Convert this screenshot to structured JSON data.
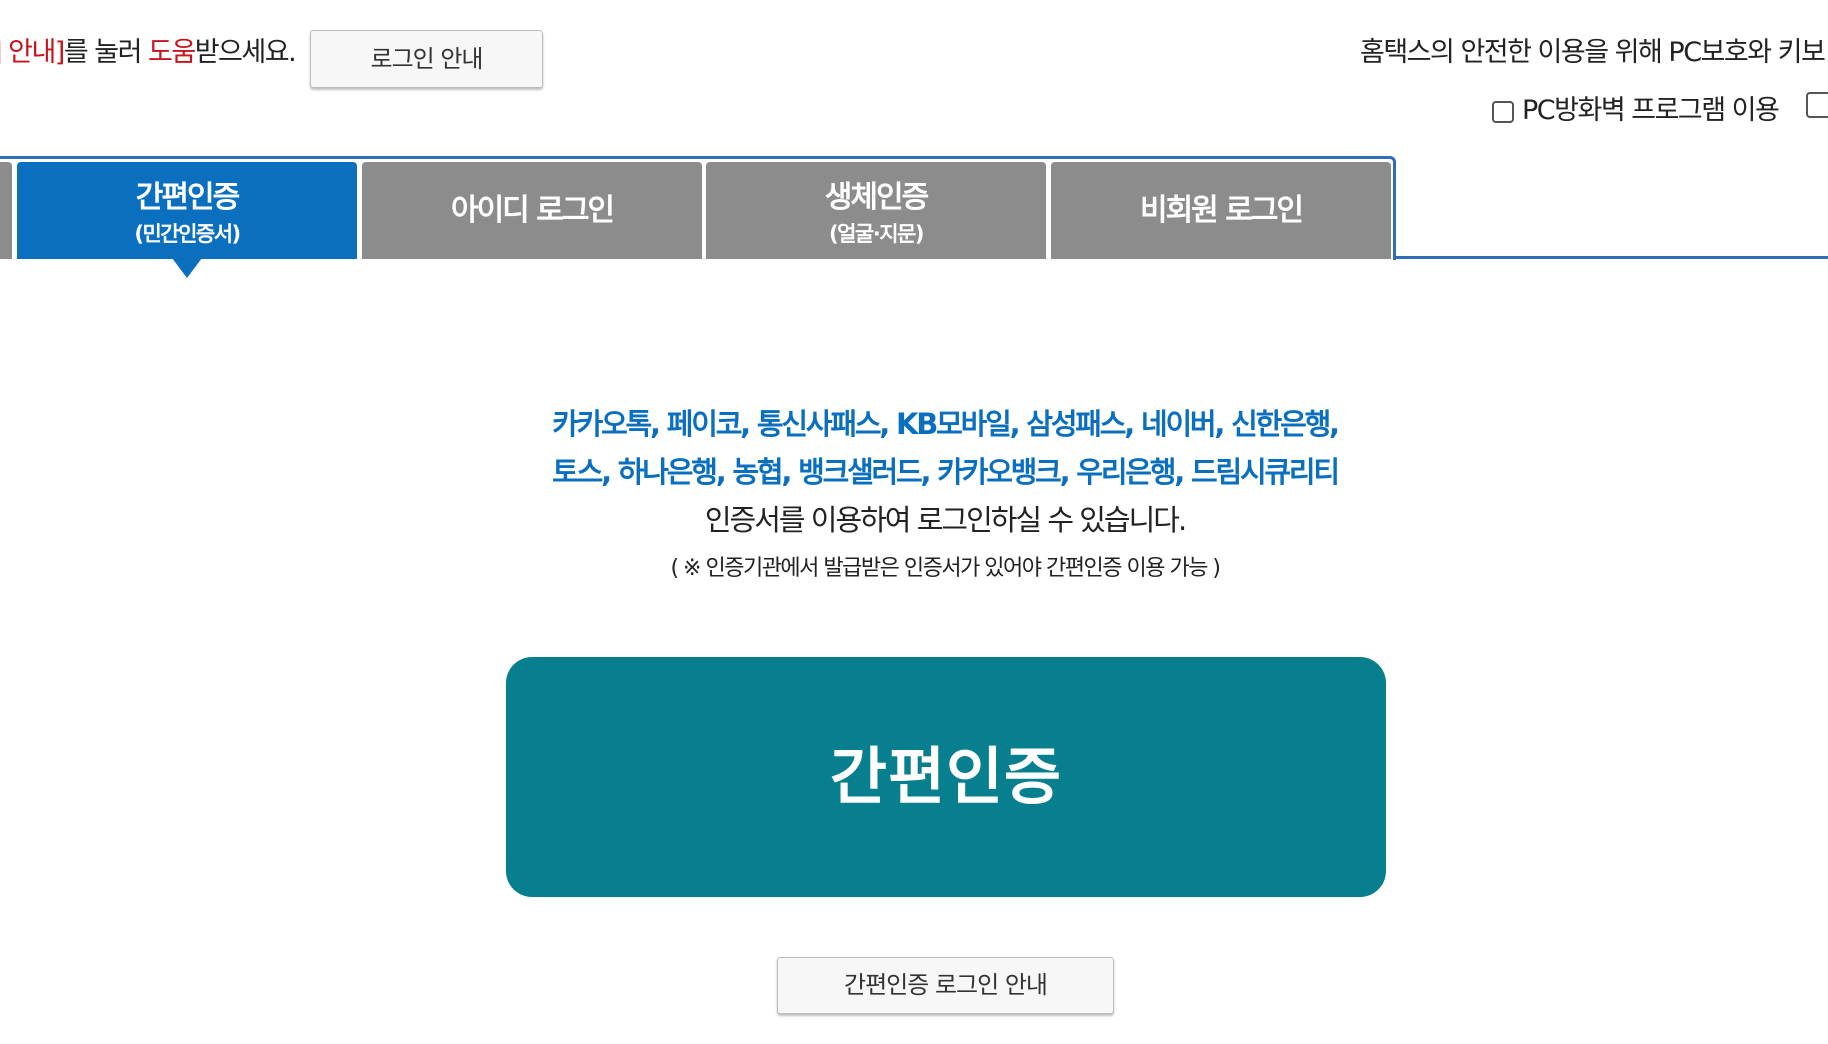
{
  "header": {
    "help_prefix_red": "] 안내]",
    "help_middle": "를 눌러 ",
    "help_red_word": "도움",
    "help_suffix": "받으세요.",
    "login_guide_button": "로그인 안내",
    "security_notice": "홈택스의 안전한 이용을 위해 PC보호와 키보",
    "firewall_label": "PC방화벽 프로그램 이용"
  },
  "tabs": [
    {
      "main": "간편인증",
      "sub": "(민간인증서)",
      "active": true
    },
    {
      "main": "아이디 로그인",
      "sub": "",
      "active": false
    },
    {
      "main": "생체인증",
      "sub": "(얼굴·지문)",
      "active": false
    },
    {
      "main": "비회원 로그인",
      "sub": "",
      "active": false
    }
  ],
  "content": {
    "providers_line1": "카카오톡, 페이코, 통신사패스, KB모바일, 삼성패스, 네이버, 신한은행,",
    "providers_line2": "토스, 하나은행, 농협, 뱅크샐러드, 카카오뱅크, 우리은행, 드림시큐리티",
    "description": "인증서를 이용하여 로그인하실 수 있습니다.",
    "note": "( ※ 인증기관에서 발급받은 인증서가 있어야 간편인증 이용 가능 )",
    "main_button": "간편인증",
    "guide_button": "간편인증 로그인 안내"
  },
  "colors": {
    "active_tab": "#0b6fbf",
    "inactive_tab": "#8c8c8c",
    "main_button": "#077f8f",
    "provider_text": "#0b6fbf",
    "help_red": "#c8141e"
  }
}
